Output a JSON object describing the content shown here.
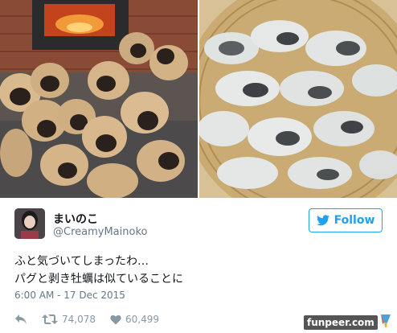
{
  "photos": {
    "left": {
      "subject": "pug puppies piled in front of a wood stove"
    },
    "right": {
      "subject": "shucked oysters in a bamboo basket"
    }
  },
  "tweet": {
    "display_name": "まいのこ",
    "handle": "@CreamyMainoko",
    "follow_label": "Follow",
    "text_lines": [
      "ふと気づいてしまったわ…",
      "パグと剥き牡蠣は似ていることに"
    ],
    "timestamp": "6:00 AM - 17 Dec 2015",
    "retweets": "74,078",
    "likes": "60,499"
  },
  "watermark": {
    "text": "funpeer.com"
  },
  "colors": {
    "accent": "#1da1f2",
    "muted": "#657786",
    "icon": "#8899a6"
  },
  "icons": [
    "twitter-bird-icon",
    "reply-icon",
    "retweet-icon",
    "heart-icon"
  ]
}
